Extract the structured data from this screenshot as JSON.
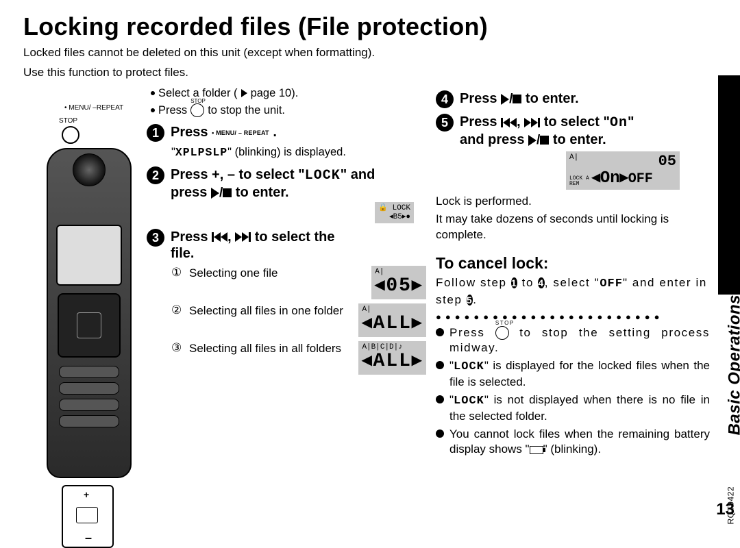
{
  "title": "Locking recorded files (File protection)",
  "intro_line1": "Locked files cannot be deleted on this unit (except when formatting).",
  "intro_line2": "Use this function to protect files.",
  "side_section": "Basic Operations",
  "page_number": "13",
  "doc_id": "RQT9422",
  "device_labels": {
    "menu_repeat": "• MENU/ –REPEAT",
    "stop": "STOP"
  },
  "prep": {
    "select_folder": "Select a folder (",
    "select_folder_page_suffix": " page 10).",
    "press_stop": "Press ",
    "press_stop_suffix": " to stop the unit."
  },
  "steps": {
    "s1": {
      "prefix": "Press ",
      "button_tiny": "• MENU/ – REPEAT",
      "suffix": ".",
      "sub": "\"XPLPSLP\" (blinking) is displayed."
    },
    "s2": {
      "line1_a": "Press +, – to select \"",
      "line1_lock": "LOCK",
      "line1_b": "\" and",
      "line2_a": "press ",
      "line2_b": " to enter.",
      "display_label": "LOCK"
    },
    "s3": {
      "line1": "Press ",
      "line1_mid": ", ",
      "line1_end": " to select the",
      "line2": "file.",
      "opt1_num": "①",
      "opt1_txt": "Selecting one file",
      "opt1_disp_top": "A|",
      "opt1_disp_big": "05",
      "opt2_num": "②",
      "opt2_txt": "Selecting all files in one folder",
      "opt2_disp_top": "A|",
      "opt2_disp_big": "ALL",
      "opt3_num": "③",
      "opt3_txt": "Selecting all files in all folders",
      "opt3_disp_top": "A|B|C|D|♪",
      "opt3_disp_big": "ALL"
    },
    "s4": {
      "a": "Press ",
      "b": " to enter."
    },
    "s5": {
      "line1_a": "Press ",
      "line1_mid": ", ",
      "line1_b": " to select \"",
      "line1_on": "On",
      "line1_c": "\"",
      "line2_a": "and press ",
      "line2_b": " to enter.",
      "disp_top": "A|",
      "disp_right_num": "05",
      "disp_side": "LOCK A\nREM",
      "disp_big": "On  OFF",
      "result1": "Lock is performed.",
      "result2": "It may take dozens of seconds until locking is complete."
    }
  },
  "cancel": {
    "heading": "To cancel lock:",
    "line_a": "Follow step ",
    "line_to": " to ",
    "line_b": ", select \"",
    "line_off": "OFF",
    "line_c": "\" and enter in step ",
    "line_d": "."
  },
  "notes": {
    "n1_a": "Press ",
    "n1_b": " to stop the setting process midway.",
    "n2_a": "\"",
    "n2_lock": "LOCK",
    "n2_b": "\" is displayed for the locked files when the file is selected.",
    "n3_a": "\"",
    "n3_lock": "LOCK",
    "n3_b": "\" is not displayed when there is no file in the selected folder.",
    "n4_a": "You cannot lock files when the remaining battery display shows \"",
    "n4_b": "\" (blinking)."
  }
}
